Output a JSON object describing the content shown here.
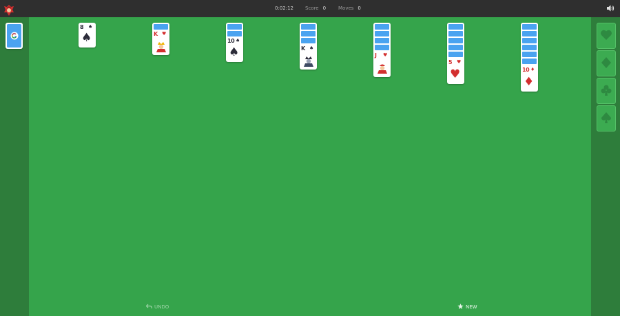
{
  "header": {
    "timer": "0:02:12",
    "score_label": "Score",
    "score_value": "0",
    "moves_label": "Moves",
    "moves_value": "0"
  },
  "stock": {
    "icon": "google-g-icon"
  },
  "foundations": [
    {
      "suit": "hearts",
      "icon": "heart-icon"
    },
    {
      "suit": "diamonds",
      "icon": "diamond-icon"
    },
    {
      "suit": "clubs",
      "icon": "club-icon"
    },
    {
      "suit": "spades",
      "icon": "spade-icon"
    }
  ],
  "tableau": [
    {
      "face_down": 0,
      "top_rank": "8",
      "top_suit": "♠",
      "color": "black"
    },
    {
      "face_down": 1,
      "top_rank": "K",
      "top_suit": "♥",
      "color": "red"
    },
    {
      "face_down": 2,
      "top_rank": "10",
      "top_suit": "♠",
      "color": "black"
    },
    {
      "face_down": 3,
      "top_rank": "K",
      "top_suit": "♠",
      "color": "black"
    },
    {
      "face_down": 4,
      "top_rank": "J",
      "top_suit": "♥",
      "color": "red"
    },
    {
      "face_down": 5,
      "top_rank": "5",
      "top_suit": "♥",
      "color": "red"
    },
    {
      "face_down": 6,
      "top_rank": "10",
      "top_suit": "♦",
      "color": "red"
    }
  ],
  "footer": {
    "undo_label": "UNDO",
    "new_label": "NEW"
  },
  "colors": {
    "felt": "#35a44b",
    "side_panel": "#2e7d3b",
    "topbar": "#2f2f2f",
    "card_back": "#4aa3f0",
    "red_suit": "#d32f2f",
    "black_suit": "#2c2c3a"
  }
}
